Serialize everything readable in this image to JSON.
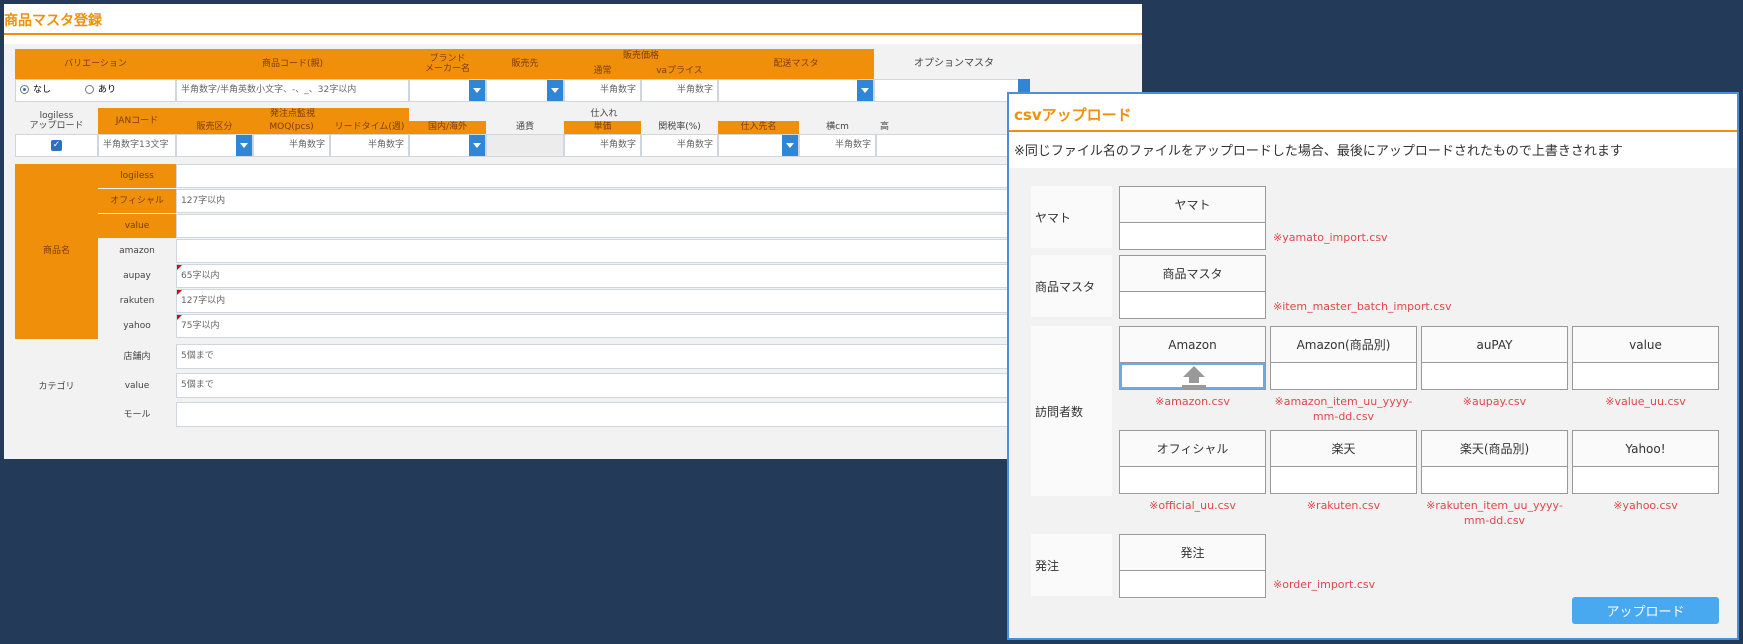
{
  "product_master": {
    "title": "商品マスタ登録",
    "header1": {
      "variation": "バリエーション",
      "product_code": "商品コード(親)",
      "brand_maker_1": "ブランド",
      "brand_maker_2": "メーカー名",
      "seller": "販売先",
      "sales_price": "販売価格",
      "normal": "通常",
      "va_price": "vaプライス",
      "shipping_master": "配送マスタ",
      "option_master": "オプションマスタ"
    },
    "row1": {
      "none": "なし",
      "exists": "あり",
      "code_placeholder": "半角数字/半角英数小文字、-、_、32字以内",
      "half_digits": "半角数字"
    },
    "header2": {
      "logiless_1": "logiless",
      "logiless_2": "アップロード",
      "jan": "JANコード",
      "order_monitor": "発注点監視",
      "sales_class": "販売区分",
      "moq": "MOQ(pcs)",
      "lead_time": "リードタイム(週)",
      "purchase": "仕入れ",
      "domestic": "国内/海外",
      "currency": "通貨",
      "unit_cost": "単価",
      "tariff": "関税率(%)",
      "supplier": "仕入先名",
      "width": "横cm",
      "height_cut": "高"
    },
    "row2": {
      "jan_placeholder": "半角数字13文字",
      "half_digits": "半角数字"
    },
    "product_name": {
      "label": "商品名",
      "rows": [
        {
          "label": "logiless",
          "placeholder": ""
        },
        {
          "label": "オフィシャル",
          "placeholder": "127字以内"
        },
        {
          "label": "value",
          "placeholder": ""
        },
        {
          "label": "amazon",
          "placeholder": ""
        },
        {
          "label": "aupay",
          "placeholder": "65字以内"
        },
        {
          "label": "rakuten",
          "placeholder": "127字以内"
        },
        {
          "label": "yahoo",
          "placeholder": "75字以内"
        }
      ]
    },
    "category": {
      "label": "カテゴリ",
      "rows": [
        {
          "label": "店舗内",
          "placeholder": "5個まで"
        },
        {
          "label": "value",
          "placeholder": "5個まで"
        },
        {
          "label": "モール",
          "placeholder": ""
        }
      ]
    }
  },
  "csv_dialog": {
    "title": "csvアップロード",
    "note": "※同じファイル名のファイルをアップロードした場合、最後にアップロードされたもので上書きされます",
    "yamato": {
      "label": "ヤマト",
      "box": "ヤマト",
      "file": "※yamato_import.csv"
    },
    "item_master": {
      "label": "商品マスタ",
      "box": "商品マスタ",
      "file": "※item_master_batch_import.csv"
    },
    "visitors": {
      "label": "訪問者数",
      "boxes": [
        {
          "box": "Amazon",
          "file1": "※amazon.csv",
          "file2": ""
        },
        {
          "box": "Amazon(商品別)",
          "file1": "※amazon_item_uu_yyyy-",
          "file2": "mm-dd.csv"
        },
        {
          "box": "auPAY",
          "file1": "※aupay.csv",
          "file2": ""
        },
        {
          "box": "value",
          "file1": "※value_uu.csv",
          "file2": ""
        },
        {
          "box": "オフィシャル",
          "file1": "※official_uu.csv",
          "file2": ""
        },
        {
          "box": "楽天",
          "file1": "※rakuten.csv",
          "file2": ""
        },
        {
          "box": "楽天(商品別)",
          "file1": "※rakuten_item_uu_yyyy-",
          "file2": "mm-dd.csv"
        },
        {
          "box": "Yahoo!",
          "file1": "※yahoo.csv",
          "file2": ""
        }
      ]
    },
    "order": {
      "label": "発注",
      "box": "発注",
      "file": "※order_import.csv"
    },
    "upload_button": "アップロード"
  },
  "colors": {
    "accent_orange": "#f0900a",
    "button_blue": "#48a8f0",
    "file_red": "#e0474c",
    "frame_navy": "#233a58"
  },
  "icons": [
    "upload-icon",
    "dropdown-arrow-icon",
    "checkbox-checked-icon",
    "radio-icon"
  ]
}
